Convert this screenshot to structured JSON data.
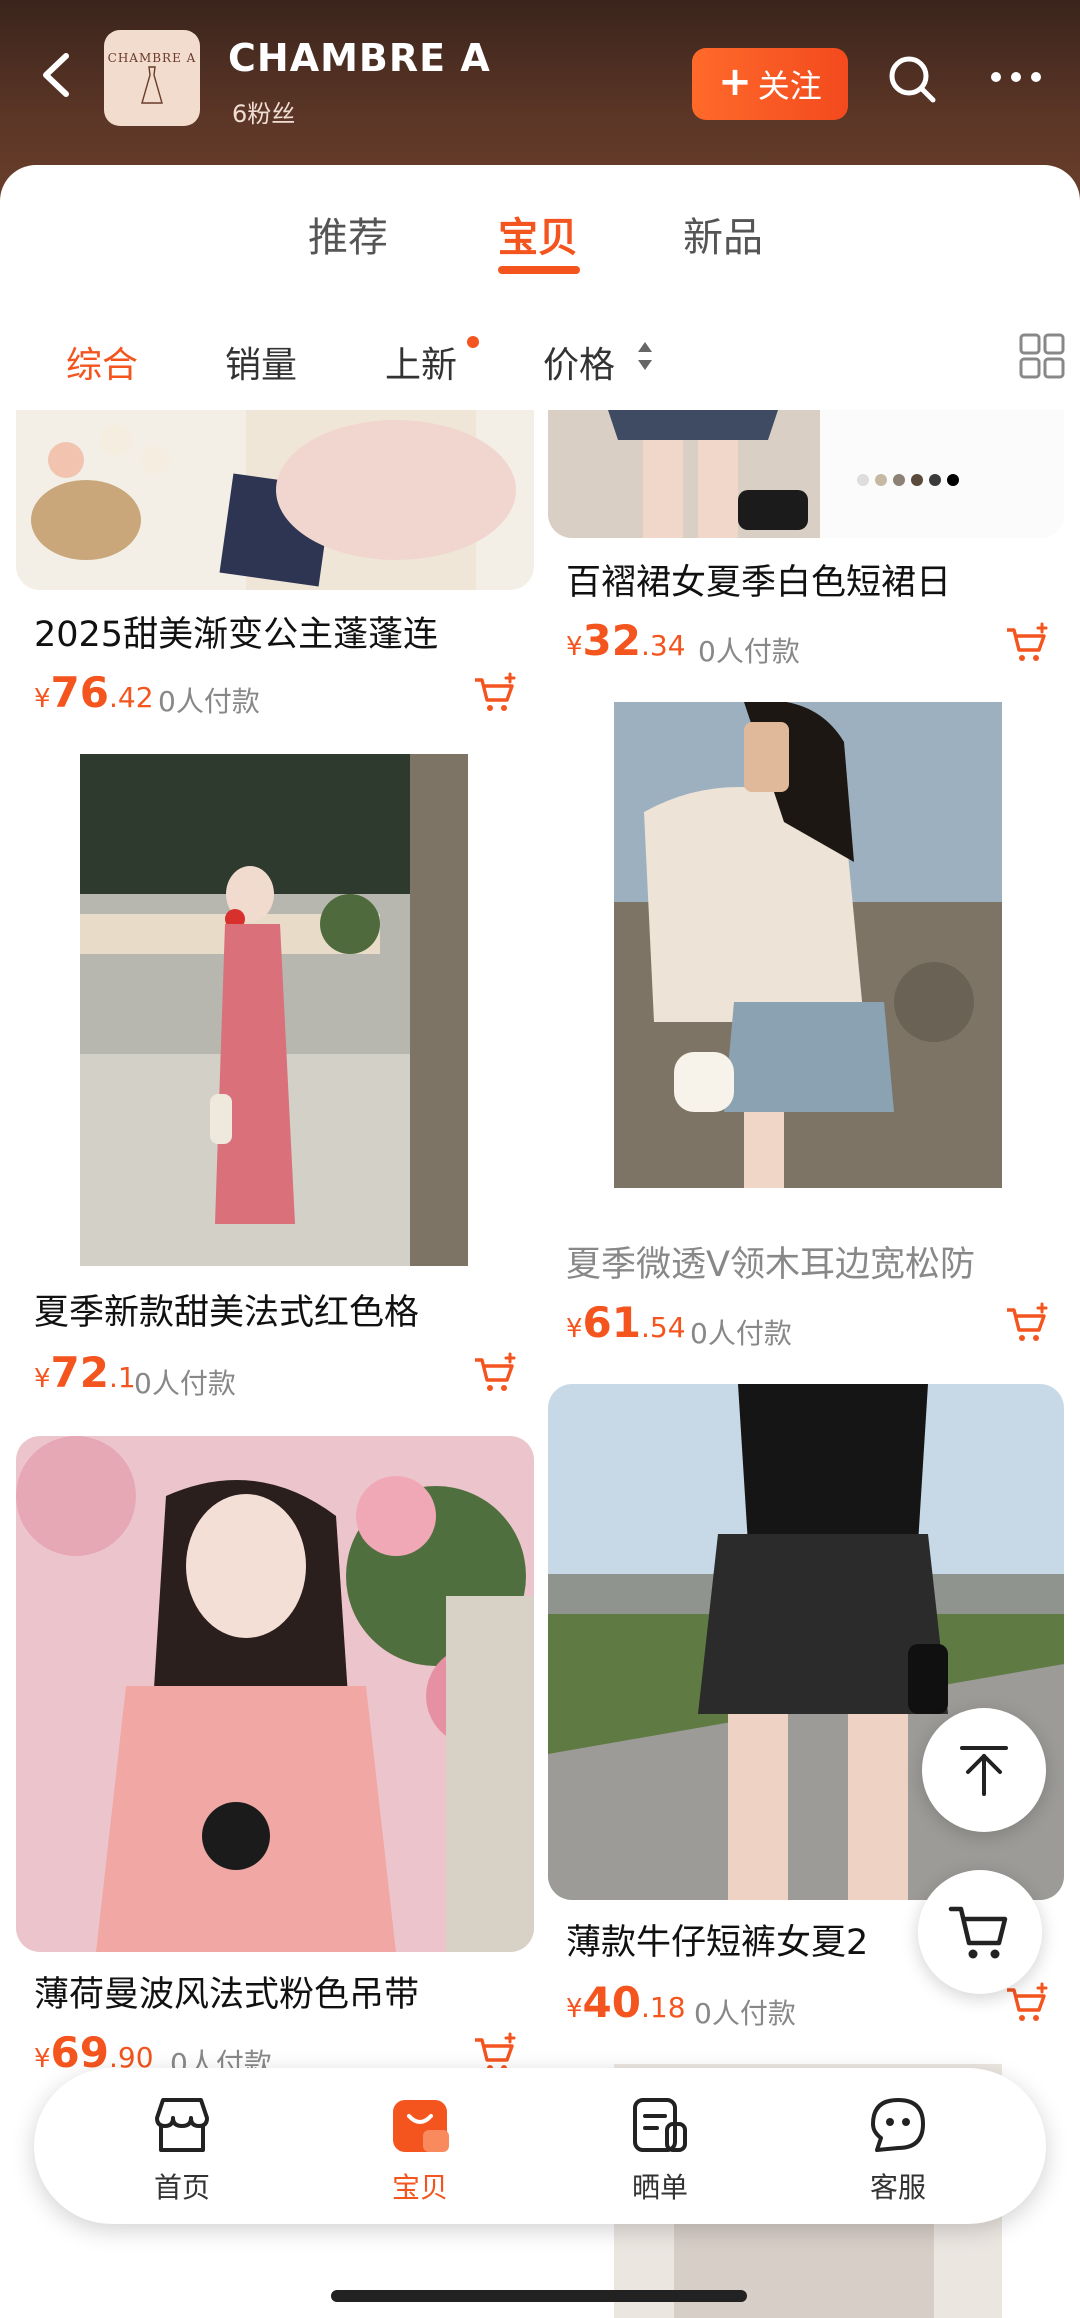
{
  "header": {
    "shop_name": "CHAMBRE A",
    "fans": "6粉丝",
    "follow_label": "关注",
    "logo_text": "CHAMBRE A"
  },
  "tabs": [
    "推荐",
    "宝贝",
    "新品"
  ],
  "sort": {
    "items": [
      "综合",
      "销量",
      "上新",
      "价格"
    ]
  },
  "products": [
    {
      "title": "2025甜美渐变公主蓬蓬连",
      "price_int": "76",
      "price_dec": ".42",
      "paid": "0人付款"
    },
    {
      "title": "百褶裙女夏季白色短裙日",
      "price_int": "32",
      "price_dec": ".34",
      "paid": "0人付款"
    },
    {
      "title": "夏季新款甜美法式红色格",
      "price_int": "72",
      "price_dec": ".1",
      "paid": "0人付款"
    },
    {
      "title": "夏季微透V领木耳边宽松防",
      "price_int": "61",
      "price_dec": ".54",
      "paid": "0人付款"
    },
    {
      "title": "薄荷曼波风法式粉色吊带",
      "price_int": "69",
      "price_dec": ".90",
      "paid": "0人付款"
    },
    {
      "title": "薄款牛仔短裤女夏2",
      "price_int": "40",
      "price_dec": ".18",
      "paid": "0人付款"
    }
  ],
  "currency": "¥",
  "bottom_nav": [
    {
      "label": "首页",
      "icon": "store-icon"
    },
    {
      "label": "宝贝",
      "icon": "bag-icon",
      "active": true
    },
    {
      "label": "晒单",
      "icon": "review-icon"
    },
    {
      "label": "客服",
      "icon": "chat-icon"
    }
  ],
  "colors": {
    "accent": "#f4541e",
    "header_bg": "#4a2c20"
  }
}
